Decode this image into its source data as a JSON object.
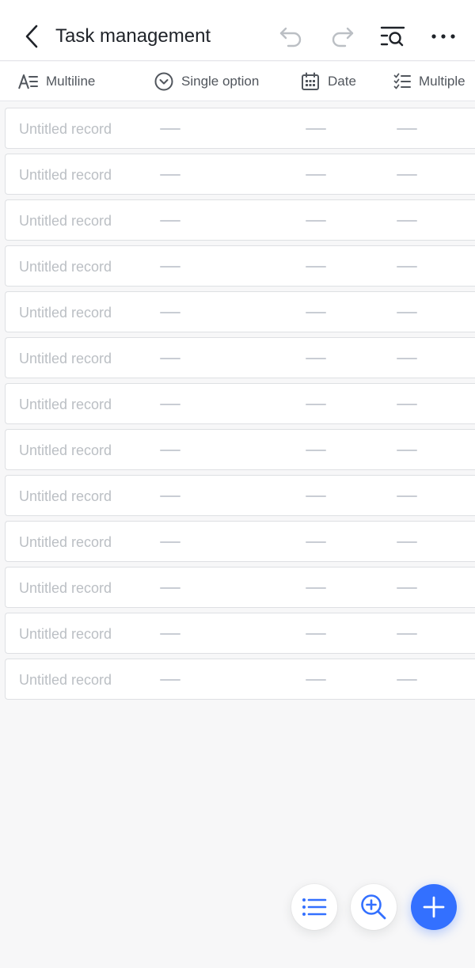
{
  "header": {
    "title": "Task management",
    "icons": [
      "chevron-left-icon",
      "undo-icon",
      "redo-icon",
      "search-list-icon",
      "more-icon"
    ]
  },
  "fields": [
    {
      "label": "Multiline",
      "icon": "multiline-text-icon"
    },
    {
      "label": "Single option",
      "icon": "single-option-icon"
    },
    {
      "label": "Date",
      "icon": "calendar-icon"
    },
    {
      "label": "Multiple",
      "icon": "checklist-icon"
    }
  ],
  "records": [
    {
      "name": "Untitled record",
      "values": [
        "—",
        "—",
        "—"
      ]
    },
    {
      "name": "Untitled record",
      "values": [
        "—",
        "—",
        "—"
      ]
    },
    {
      "name": "Untitled record",
      "values": [
        "—",
        "—",
        "—"
      ]
    },
    {
      "name": "Untitled record",
      "values": [
        "—",
        "—",
        "—"
      ]
    },
    {
      "name": "Untitled record",
      "values": [
        "—",
        "—",
        "—"
      ]
    },
    {
      "name": "Untitled record",
      "values": [
        "—",
        "—",
        "—"
      ]
    },
    {
      "name": "Untitled record",
      "values": [
        "—",
        "—",
        "—"
      ]
    },
    {
      "name": "Untitled record",
      "values": [
        "—",
        "—",
        "—"
      ]
    },
    {
      "name": "Untitled record",
      "values": [
        "—",
        "—",
        "—"
      ]
    },
    {
      "name": "Untitled record",
      "values": [
        "—",
        "—",
        "—"
      ]
    },
    {
      "name": "Untitled record",
      "values": [
        "—",
        "—",
        "—"
      ]
    },
    {
      "name": "Untitled record",
      "values": [
        "—",
        "—",
        "—"
      ]
    },
    {
      "name": "Untitled record",
      "values": [
        "—",
        "—",
        "—"
      ]
    }
  ],
  "fabs": [
    {
      "icon": "list-icon"
    },
    {
      "icon": "zoom-in-icon"
    },
    {
      "icon": "plus-icon"
    }
  ],
  "colors": {
    "accent": "#3370ff",
    "text": "#1f2329",
    "placeholder": "#bbbfc4",
    "disabled_icon": "#bbbfc4"
  }
}
